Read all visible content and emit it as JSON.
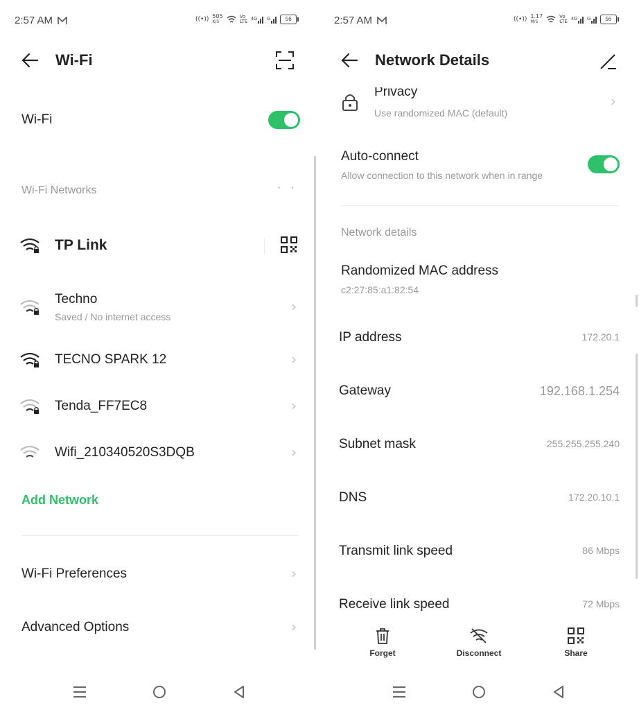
{
  "left": {
    "status": {
      "time": "2:57 AM",
      "speed": "505",
      "speed_unit": "K/S",
      "battery": "56"
    },
    "header": {
      "title": "Wi-Fi"
    },
    "wifi_toggle": {
      "label": "Wi-Fi",
      "on": true
    },
    "networks_header": "Wi-Fi Networks",
    "connected": {
      "name": "TP Link"
    },
    "networks": [
      {
        "name": "Techno",
        "sub": "Saved / No internet access"
      },
      {
        "name": "TECNO SPARK 12",
        "sub": ""
      },
      {
        "name": "Tenda_FF7EC8",
        "sub": ""
      },
      {
        "name": "Wifi_210340520S3DQB",
        "sub": ""
      }
    ],
    "add_network": "Add Network",
    "preferences": "Wi-Fi Preferences",
    "advanced": "Advanced Options"
  },
  "right": {
    "status": {
      "time": "2:57 AM",
      "speed": "1.17",
      "speed_unit": "M/S",
      "battery": "56"
    },
    "header": {
      "title": "Network Details"
    },
    "privacy": {
      "title": "Privacy",
      "sub": "Use randomized MAC (default)"
    },
    "auto_connect": {
      "title": "Auto-connect",
      "sub": "Allow connection to this network when in range",
      "on": true
    },
    "details_header": "Network details",
    "mac": {
      "title": "Randomized MAC address",
      "value": "c2:27:85:a1:82:54"
    },
    "rows": [
      {
        "label": "IP address",
        "value": "172.20.1"
      },
      {
        "label": "Gateway",
        "value": "192.168.1.254"
      },
      {
        "label": "Subnet mask",
        "value": "255.255.255.240"
      },
      {
        "label": "DNS",
        "value": "172.20.10.1"
      },
      {
        "label": "Transmit link speed",
        "value": "86 Mbps"
      },
      {
        "label": "Receive link speed",
        "value": "72 Mbps"
      }
    ],
    "actions": {
      "forget": "Forget",
      "disconnect": "Disconnect",
      "share": "Share"
    }
  },
  "icons": [
    "back-arrow-icon",
    "scan-icon",
    "wifi-icon",
    "qr-code-icon",
    "chevron-right-icon",
    "lock-icon",
    "edit-icon",
    "trash-icon",
    "wifi-off-icon",
    "menu-icon",
    "home-icon",
    "back-icon"
  ],
  "colors": {
    "accent": "#2fc06a",
    "text": "#222222",
    "muted": "#999999"
  }
}
